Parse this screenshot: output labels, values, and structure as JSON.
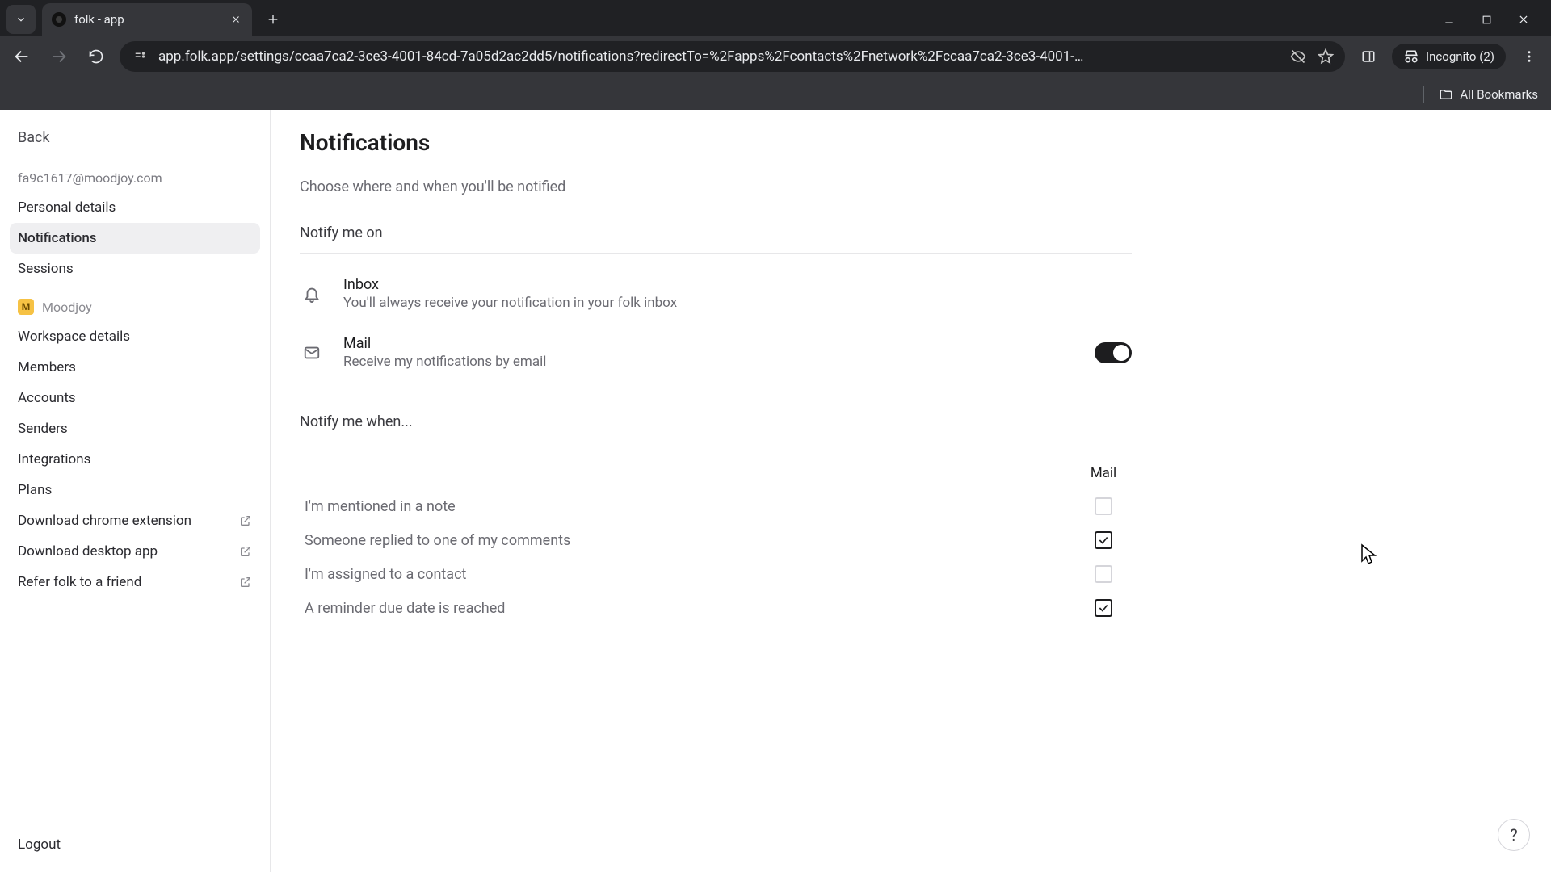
{
  "browser": {
    "tab_title": "folk - app",
    "url": "app.folk.app/settings/ccaa7ca2-3ce3-4001-84cd-7a05d2ac2dd5/notifications?redirectTo=%2Fapps%2Fcontacts%2Fnetwork%2Fccaa7ca2-3ce3-4001-…",
    "incognito_label": "Incognito (2)",
    "all_bookmarks": "All Bookmarks"
  },
  "sidebar": {
    "back": "Back",
    "email": "fa9c1617@moodjoy.com",
    "items_user": [
      "Personal details",
      "Notifications",
      "Sessions"
    ],
    "workspace_name": "Moodjoy",
    "workspace_initial": "M",
    "items_ws": [
      "Workspace details",
      "Members",
      "Accounts",
      "Senders",
      "Integrations",
      "Plans"
    ],
    "items_ext": [
      "Download chrome extension",
      "Download desktop app",
      "Refer folk to a friend"
    ],
    "logout": "Logout"
  },
  "page": {
    "title": "Notifications",
    "subtitle": "Choose where and when you'll be notified",
    "section_on": "Notify me on",
    "channels": [
      {
        "icon": "bell-icon",
        "title": "Inbox",
        "desc": "You'll always receive your notification in your folk inbox",
        "toggle": null
      },
      {
        "icon": "mail-icon",
        "title": "Mail",
        "desc": "Receive my notifications by email",
        "toggle": true
      }
    ],
    "section_when": "Notify me when...",
    "when_column": "Mail",
    "when_rows": [
      {
        "label": "I'm mentioned in a note",
        "checked": false
      },
      {
        "label": "Someone replied to one of my comments",
        "checked": true
      },
      {
        "label": "I'm assigned to a contact",
        "checked": false
      },
      {
        "label": "A reminder due date is reached",
        "checked": true
      }
    ]
  },
  "help": "?"
}
